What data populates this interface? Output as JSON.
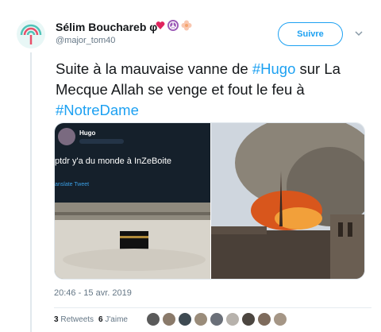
{
  "user": {
    "name": "Sélim Bouchareb φ",
    "handle": "@major_tom40"
  },
  "follow_label": "Suivre",
  "tweet": {
    "part1": "Suite à la mauvaise vanne de ",
    "tag1": "#Hugo",
    "part2": " sur La Mecque Allah se venge et fout le feu à ",
    "tag2": "#NotreDame"
  },
  "embedded": {
    "name": "Hugo",
    "text": "ptdr y'a du monde à InZeBoite",
    "translate": "anslate Tweet"
  },
  "timestamp": "20:46 - 15 avr. 2019",
  "stats": {
    "retweets_count": "3",
    "retweets_label": "Retweets",
    "likes_count": "6",
    "likes_label": "J'aime"
  },
  "colors": {
    "accent": "#1da1f2",
    "text": "#14171a",
    "muted": "#657786"
  },
  "likers_count": 9
}
